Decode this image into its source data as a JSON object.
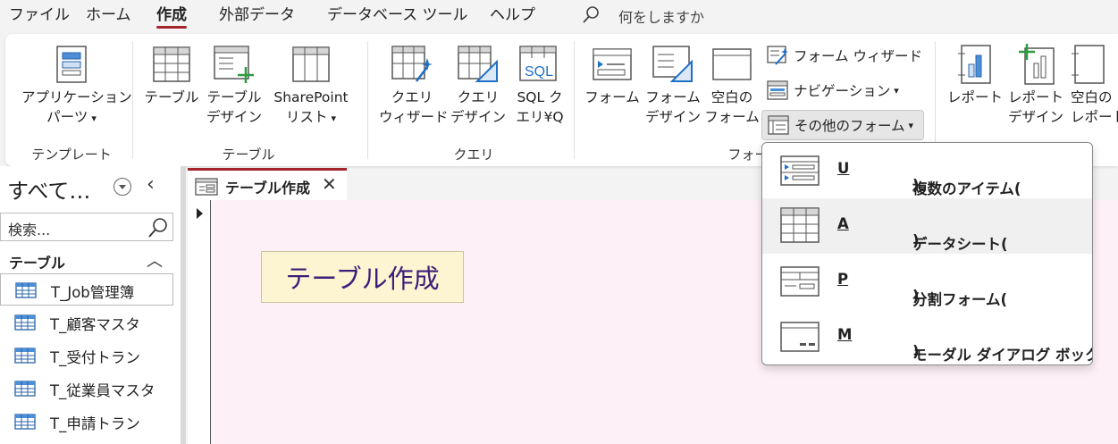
{
  "menu": {
    "items": [
      "ファイル",
      "ホーム",
      "作成",
      "外部データ",
      "データベース ツール",
      "ヘルプ"
    ],
    "active": "作成",
    "search_text": "何をしますか"
  },
  "ribbon": {
    "groups": {
      "template": "テンプレート",
      "table": "テーブル",
      "query": "クエリ",
      "form": "フォー"
    },
    "app_parts": [
      "アプリケーション",
      "パーツ"
    ],
    "table_btn": "テーブル",
    "table_design": [
      "テーブル",
      "デザイン"
    ],
    "sharepoint_list": [
      "SharePoint",
      "リスト"
    ],
    "query_wizard": [
      "クエリ",
      "ウィザード"
    ],
    "query_design": [
      "クエリ",
      "デザイン"
    ],
    "sql_query": [
      "SQL ク",
      "エリ¥Q"
    ],
    "form_btn": "フォーム",
    "form_design": [
      "フォーム",
      "デザイン"
    ],
    "blank_form": [
      "空白の",
      "フォーム"
    ],
    "form_wizard": "フォーム ウィザード",
    "navigation": "ナビゲーション",
    "more_forms": "その他のフォーム",
    "report_btn": "レポート",
    "report_design": [
      "レポート",
      "デザイン"
    ],
    "blank_report": [
      "空白の",
      "レポート"
    ]
  },
  "nav": {
    "title": "すべて…",
    "search_placeholder": "検索...",
    "group": "テーブル",
    "items": [
      "T_Job管理簿",
      "T_顧客マスタ",
      "T_受付トラン",
      "T_従業員マスタ",
      "T_申請トラン"
    ],
    "selected_index": 0
  },
  "document": {
    "tab_label": "テーブル作成",
    "close_glyph": "✕",
    "label_text": "テーブル作成"
  },
  "dropdown": {
    "items": [
      {
        "text": "複数のアイテム(",
        "key": "U",
        "tail": ")"
      },
      {
        "text": "データシート(",
        "key": "A",
        "tail": ")"
      },
      {
        "text": "分割フォーム(",
        "key": "P",
        "tail": ")"
      },
      {
        "text": "モーダル ダイアログ ボックス(",
        "key": "M",
        "tail": ")"
      }
    ],
    "hover_index": 1
  },
  "colors": {
    "accent": "#a4262c",
    "form_bg": "#fdf1f7",
    "label_bg": "#fdf5d2",
    "label_text": "#3a1e7a"
  }
}
